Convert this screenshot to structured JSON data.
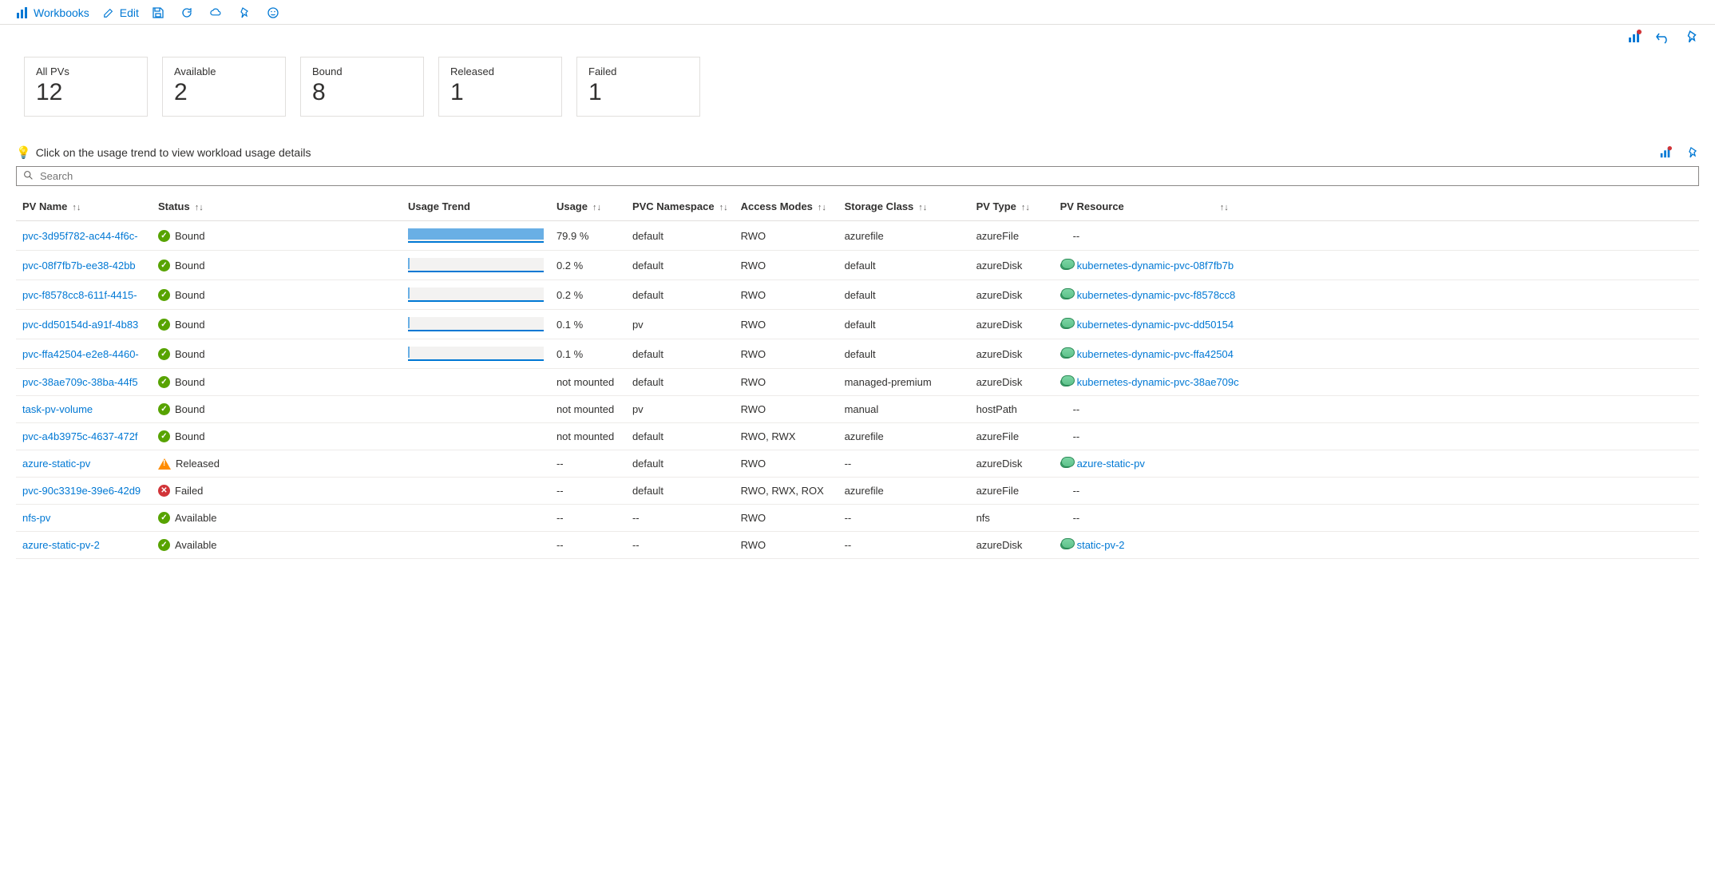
{
  "toolbar": {
    "workbooks_label": "Workbooks",
    "edit_label": "Edit"
  },
  "cards": [
    {
      "label": "All PVs",
      "value": "12"
    },
    {
      "label": "Available",
      "value": "2"
    },
    {
      "label": "Bound",
      "value": "8"
    },
    {
      "label": "Released",
      "value": "1"
    },
    {
      "label": "Failed",
      "value": "1"
    }
  ],
  "hint": "Click on the usage trend to view workload usage details",
  "search_placeholder": "Search",
  "columns": {
    "pv_name": "PV Name",
    "status": "Status",
    "usage_trend": "Usage Trend",
    "usage": "Usage",
    "pvc_namespace": "PVC Namespace",
    "access_modes": "Access Modes",
    "storage_class": "Storage Class",
    "pv_type": "PV Type",
    "pv_resource": "PV Resource"
  },
  "rows": [
    {
      "name": "pvc-3d95f782-ac44-4f6c-",
      "status": "Bound",
      "status_kind": "ok",
      "trend_pct": 100,
      "usage": "79.9 %",
      "ns": "default",
      "am": "RWO",
      "sc": "azurefile",
      "type": "azureFile",
      "res": "--",
      "res_link": false
    },
    {
      "name": "pvc-08f7fb7b-ee38-42bb",
      "status": "Bound",
      "status_kind": "ok",
      "trend_pct": 1,
      "usage": "0.2 %",
      "ns": "default",
      "am": "RWO",
      "sc": "default",
      "type": "azureDisk",
      "res": "kubernetes-dynamic-pvc-08f7fb7b",
      "res_link": true
    },
    {
      "name": "pvc-f8578cc8-611f-4415-",
      "status": "Bound",
      "status_kind": "ok",
      "trend_pct": 1,
      "usage": "0.2 %",
      "ns": "default",
      "am": "RWO",
      "sc": "default",
      "type": "azureDisk",
      "res": "kubernetes-dynamic-pvc-f8578cc8",
      "res_link": true
    },
    {
      "name": "pvc-dd50154d-a91f-4b83",
      "status": "Bound",
      "status_kind": "ok",
      "trend_pct": 1,
      "usage": "0.1 %",
      "ns": "pv",
      "am": "RWO",
      "sc": "default",
      "type": "azureDisk",
      "res": "kubernetes-dynamic-pvc-dd50154",
      "res_link": true
    },
    {
      "name": "pvc-ffa42504-e2e8-4460-",
      "status": "Bound",
      "status_kind": "ok",
      "trend_pct": 1,
      "usage": "0.1 %",
      "ns": "default",
      "am": "RWO",
      "sc": "default",
      "type": "azureDisk",
      "res": "kubernetes-dynamic-pvc-ffa42504",
      "res_link": true
    },
    {
      "name": "pvc-38ae709c-38ba-44f5",
      "status": "Bound",
      "status_kind": "ok",
      "trend_pct": -1,
      "usage": "not mounted",
      "ns": "default",
      "am": "RWO",
      "sc": "managed-premium",
      "type": "azureDisk",
      "res": "kubernetes-dynamic-pvc-38ae709c",
      "res_link": true
    },
    {
      "name": "task-pv-volume",
      "status": "Bound",
      "status_kind": "ok",
      "trend_pct": -1,
      "usage": "not mounted",
      "ns": "pv",
      "am": "RWO",
      "sc": "manual",
      "type": "hostPath",
      "res": "--",
      "res_link": false
    },
    {
      "name": "pvc-a4b3975c-4637-472f",
      "status": "Bound",
      "status_kind": "ok",
      "trend_pct": -1,
      "usage": "not mounted",
      "ns": "default",
      "am": "RWO, RWX",
      "sc": "azurefile",
      "type": "azureFile",
      "res": "--",
      "res_link": false
    },
    {
      "name": "azure-static-pv",
      "status": "Released",
      "status_kind": "warn",
      "trend_pct": -1,
      "usage": "--",
      "ns": "default",
      "am": "RWO",
      "sc": "--",
      "type": "azureDisk",
      "res": "azure-static-pv",
      "res_link": true
    },
    {
      "name": "pvc-90c3319e-39e6-42d9",
      "status": "Failed",
      "status_kind": "fail",
      "trend_pct": -1,
      "usage": "--",
      "ns": "default",
      "am": "RWO, RWX, ROX",
      "sc": "azurefile",
      "type": "azureFile",
      "res": "--",
      "res_link": false
    },
    {
      "name": "nfs-pv",
      "status": "Available",
      "status_kind": "ok",
      "trend_pct": -1,
      "usage": "--",
      "ns": "--",
      "am": "RWO",
      "sc": "--",
      "type": "nfs",
      "res": "--",
      "res_link": false
    },
    {
      "name": "azure-static-pv-2",
      "status": "Available",
      "status_kind": "ok",
      "trend_pct": -1,
      "usage": "--",
      "ns": "--",
      "am": "RWO",
      "sc": "--",
      "type": "azureDisk",
      "res": "static-pv-2",
      "res_link": true
    }
  ]
}
